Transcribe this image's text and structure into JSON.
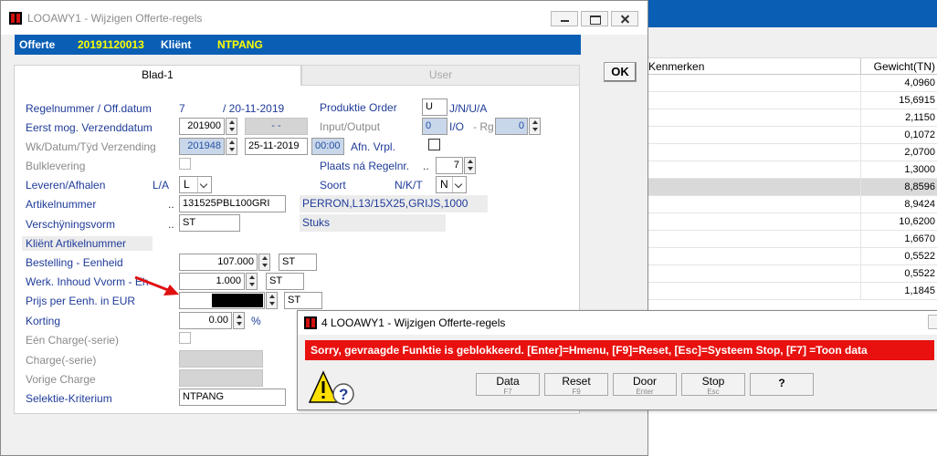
{
  "main": {
    "title": "LOOAWY1 - Wijzigen Offerte-regels",
    "info": {
      "offerte_label": "Offerte",
      "offerte_value": "20191120013",
      "klient_label": "Kliënt",
      "klient_value": "NTPANG"
    },
    "ok_label": "OK",
    "tabs": [
      {
        "label": "Blad-1"
      },
      {
        "label": "User"
      }
    ]
  },
  "form": {
    "regelnummer_label": "Regelnummer / Off.datum",
    "regelnummer_value": "7",
    "offdatum_value": "/ 20-11-2019",
    "produktie_label": "Produktie Order",
    "produktie_value": "U",
    "produktie_options": "J/N/U/A",
    "eerst_label": "Eerst mog. Verzenddatum",
    "eerst_value": "201900",
    "eerst_dash": "- -",
    "io_label": "Input/Output",
    "io_value": "0",
    "io_text": "I/O",
    "rg_label": "- Rg",
    "rg_value": "0",
    "wk_label": "Wk/Datum/Tÿd Verzending",
    "wk_value": "201948",
    "wk_date": "25-11-2019",
    "wk_time": "00:00",
    "afn_label": "Afn. Vrpl.",
    "bulk_label": "Bulklevering",
    "plaats_label": "Plaats ná Regelnr.",
    "plaats_value": "7",
    "leveren_label": "Leveren/Afhalen",
    "leveren_code": "L/A",
    "leveren_value": "L",
    "soort_label": "Soort",
    "soort_code": "N/K/T",
    "soort_value": "N",
    "artikel_label": "Artikelnummer",
    "artikel_value": "131525PBL100GRI",
    "artikel_desc": "PERRON,L13/15X25,GRIJS,1000",
    "versch_label": "Verschÿningsvorm",
    "versch_value": "ST",
    "versch_desc": "Stuks",
    "klient_art_label": "Kliënt Artikelnummer",
    "bestelling_label": "Bestelling - Eenheid",
    "bestelling_value": "107.000",
    "bestelling_unit": "ST",
    "werk_label": "Werk. Inhoud Vvorm - Eh",
    "werk_value": "1.000",
    "werk_unit": "ST",
    "prijs_label": "Prijs per Eenh. in EUR",
    "prijs_unit": "ST",
    "korting_label": "Korting",
    "korting_value": "0.00",
    "korting_unit": "%",
    "een_charge_label": "Eén Charge(-serie)",
    "charge_label": "Charge(-serie)",
    "vorige_label": "Vorige Charge",
    "selektie_label": "Selektie-Kriterium",
    "selektie_value": "NTPANG",
    "dots": ".."
  },
  "background": {
    "col1": "Kenmerken",
    "col2": "Gewicht(TN)",
    "rows": [
      "4,0960",
      "15,6915",
      "2,1150",
      "0,1072",
      "2,0700",
      "1,3000",
      "8,8596",
      "8,9424",
      "10,6200",
      "1,6670",
      "0,5522",
      "0,5522",
      "1,1845"
    ],
    "selected_index": 6
  },
  "dialog": {
    "title": "4 LOOAWY1 - Wijzigen Offerte-regels",
    "message": "Sorry, gevraagde Funktie is geblokkeerd.  [Enter]=Hmenu, [F9]=Reset, [Esc]=Systeem Stop, [F7] =Toon data",
    "buttons": [
      {
        "label": "Data",
        "key": "F7"
      },
      {
        "label": "Reset",
        "key": "F9"
      },
      {
        "label": "Door",
        "key": "Enter"
      },
      {
        "label": "Stop",
        "key": "Esc"
      }
    ],
    "help_label": "?"
  },
  "colors": {
    "title_blue": "#0a5fb5",
    "label_blue": "#1f3c99",
    "highlight_yellow": "#ffff00",
    "error_red": "#e8110f"
  },
  "icons": {
    "app": "app-icon",
    "warning": "warning-icon",
    "help": "help-icon",
    "arrow": "red-arrow-icon"
  }
}
